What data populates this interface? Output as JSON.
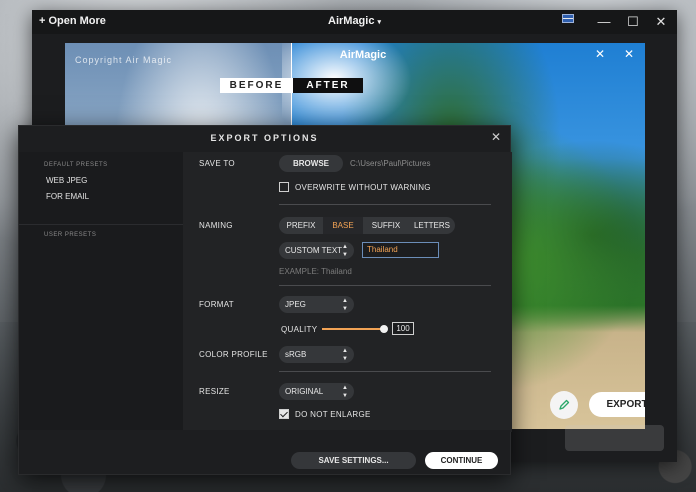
{
  "app": {
    "open_more": "+ Open More",
    "title": "AirMagic",
    "title_caret": "▾",
    "minimize": "—",
    "maximize": "☐",
    "close": "✕"
  },
  "preview": {
    "title": "AirMagic",
    "watermark": "Copyright Air Magic",
    "before_label": "BEFORE",
    "after_label": "AFTER",
    "export_label": "EXPORT",
    "close": "✕"
  },
  "dialog": {
    "title": "EXPORT OPTIONS",
    "close": "✕",
    "sidebar": {
      "default_presets_title": "DEFAULT PRESETS",
      "default_presets": [
        "WEB JPEG",
        "FOR EMAIL"
      ],
      "user_presets_title": "USER PRESETS"
    },
    "save_to": {
      "label": "SAVE TO",
      "browse": "BROWSE",
      "path": "C:\\Users\\Paul\\Pictures",
      "overwrite_label": "OVERWRITE WITHOUT WARNING",
      "overwrite_checked": false
    },
    "naming": {
      "label": "NAMING",
      "tabs": [
        "PREFIX",
        "BASE",
        "SUFFIX",
        "LETTERS"
      ],
      "active_tab": "BASE",
      "mode": "CUSTOM TEXT",
      "custom_text": "Thailand",
      "example": "EXAMPLE: Thailand"
    },
    "format": {
      "label": "FORMAT",
      "value": "JPEG",
      "quality_label": "QUALITY",
      "quality": 100
    },
    "color_profile": {
      "label": "COLOR PROFILE",
      "value": "sRGB"
    },
    "resize": {
      "label": "RESIZE",
      "value": "ORIGINAL",
      "do_not_enlarge_label": "DO NOT ENLARGE",
      "do_not_enlarge_checked": true
    },
    "footer": {
      "save_settings": "SAVE SETTINGS...",
      "continue": "CONTINUE"
    }
  },
  "colors": {
    "accent": "#f2a355",
    "dialog_bg": "#1d1e20",
    "panel_bg": "#222325",
    "input_border": "#6b8db8"
  },
  "icons": [
    "flag-icon",
    "close-icon",
    "minimize-icon",
    "maximize-icon",
    "pencil-icon",
    "updown-chevron-icon",
    "checkbox-icon"
  ]
}
